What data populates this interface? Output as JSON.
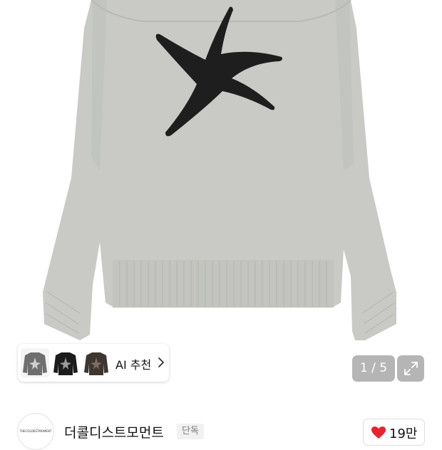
{
  "product": {
    "image_counter": "1 / 5",
    "ai_recommend_label": "AI 추천",
    "thumbnail_colors": [
      "#6f6f6f",
      "#1c1c1c",
      "#3e3631"
    ]
  },
  "brand": {
    "name": "더콜디스트모먼트",
    "badge": "단독",
    "logo_text": "THECOLDESTMOMENT",
    "like_count": "19만"
  },
  "colors": {
    "like_heart": "#e8222e",
    "sweater": "#c8c9c4",
    "star": "#1e1e1e"
  }
}
